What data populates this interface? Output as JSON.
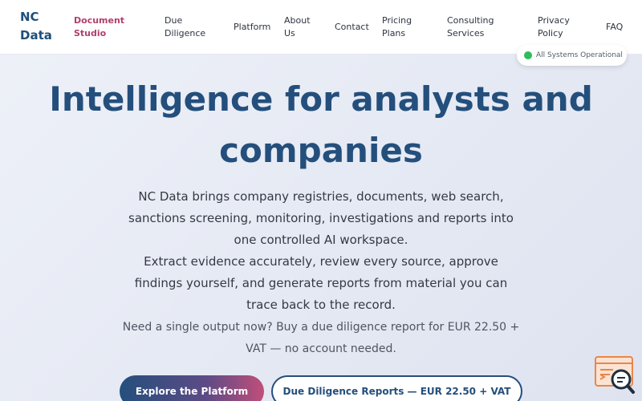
{
  "brand": {
    "name_line1": "NC",
    "name_line2": "Data"
  },
  "nav": {
    "items": [
      {
        "line1": "Document",
        "line2": "Studio"
      },
      {
        "line1": "Due",
        "line2": "Diligence"
      },
      {
        "line1": "Platform",
        "line2": ""
      },
      {
        "line1": "About",
        "line2": "Us"
      },
      {
        "line1": "Contact",
        "line2": ""
      },
      {
        "line1": "Pricing",
        "line2": "Plans"
      },
      {
        "line1": "Consulting",
        "line2": "Services"
      },
      {
        "line1": "Privacy",
        "line2": "Policy"
      },
      {
        "line1": "FAQ",
        "line2": ""
      }
    ]
  },
  "status": {
    "label": "All Systems Operational",
    "color": "#2dbd5a"
  },
  "hero": {
    "title_line1": "Intelligence for analysts and",
    "title_line2": "companies",
    "description_p1": "NC Data brings company registries, documents, web search, sanctions screening, monitoring, investigations and reports into one controlled AI workspace.",
    "description_p2": "Extract evidence accurately, review every source, approve findings yourself, and generate reports from material you can trace back to the record.",
    "note": "Need a single output now? Buy a due diligence report for EUR 22.50 + VAT — no account needed."
  },
  "buttons": {
    "primary": "Explore the Platform",
    "secondary": "Due Diligence Reports — EUR 22.50 + VAT"
  },
  "colors": {
    "brand_blue": "#244f7c",
    "accent_pink": "#b0406e",
    "chat_orange": "#e8874a"
  },
  "icons": {
    "chat": "search-chat-icon"
  }
}
